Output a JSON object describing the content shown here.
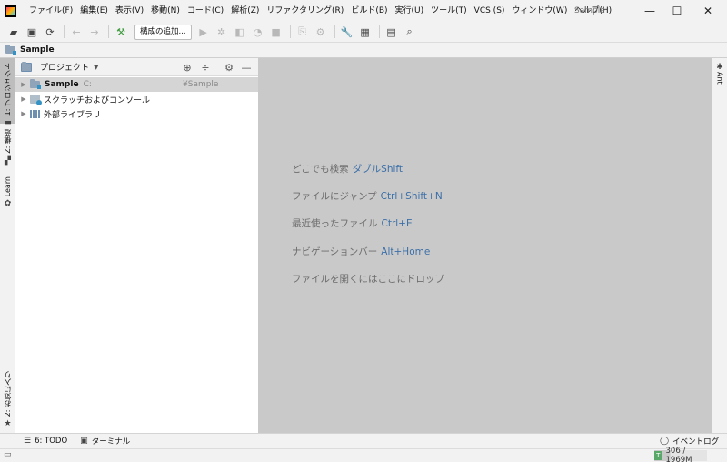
{
  "menu": {
    "items": [
      "ファイル(F)",
      "編集(E)",
      "表示(V)",
      "移動(N)",
      "コード(C)",
      "解析(Z)",
      "リファクタリング(R)",
      "ビルド(B)",
      "実行(U)",
      "ツール(T)",
      "VCS (S)",
      "ウィンドウ(W)",
      "ヘルプ(H)"
    ],
    "window_title": "Sample"
  },
  "window_controls": {
    "minimize": "—",
    "maximize": "☐",
    "close": "✕"
  },
  "toolbar": {
    "config_label": "構成の追加..."
  },
  "navbar": {
    "breadcrumb": "Sample"
  },
  "left_strip": {
    "project_tab": "1: プロジェクト",
    "structure_tab": "Z: 構造",
    "learn_tab": "Learn",
    "favorites_tab": "2: お気に入り"
  },
  "right_strip": {
    "ant_tab": "Ant"
  },
  "project_panel": {
    "title": "プロジェクト",
    "tree": [
      {
        "label": "Sample",
        "path": "C:",
        "path2": "¥Sample"
      },
      {
        "label": "スクラッチおよびコンソール"
      },
      {
        "label": "外部ライブラリ"
      }
    ]
  },
  "editor_hints": [
    {
      "text": "どこでも検索",
      "key": "ダブルShift"
    },
    {
      "text": "ファイルにジャンプ",
      "key": "Ctrl+Shift+N"
    },
    {
      "text": "最近使ったファイル",
      "key": "Ctrl+E"
    },
    {
      "text": "ナビゲーションバー",
      "key": "Alt+Home"
    },
    {
      "text": "ファイルを開くにはここにドロップ",
      "key": ""
    }
  ],
  "bottom_tools": {
    "todo": "6: TODO",
    "terminal": "ターミナル",
    "event_log": "イベントログ"
  },
  "status": {
    "memory": "306 / 1969M",
    "memory_fraction": 0.16
  },
  "colors": {
    "accent_key": "#3b6fa8",
    "editor_bg": "#c9c9c9"
  }
}
